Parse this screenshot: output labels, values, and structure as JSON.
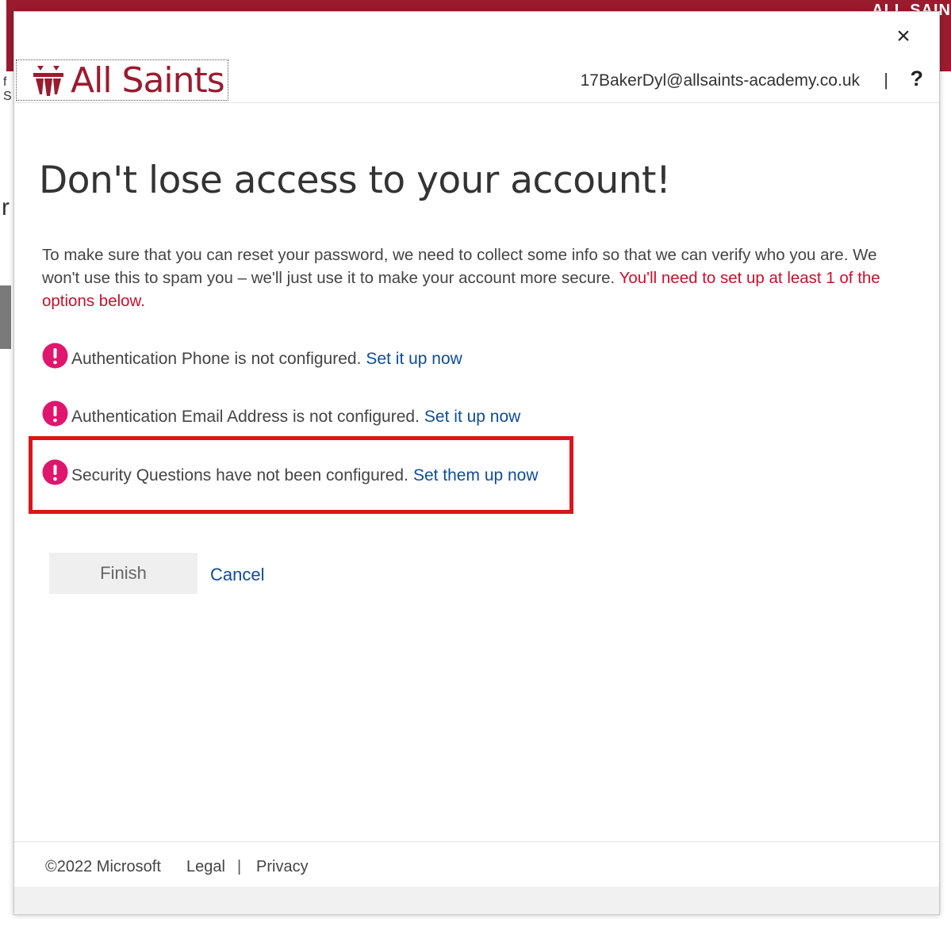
{
  "background": {
    "brand_text": "ALL SAIN",
    "left_glyph": "r",
    "left_small": "f\nS"
  },
  "dialog": {
    "close_label": "×",
    "logo_text": "All Saints",
    "user_email": "17BakerDyl@allsaints-academy.co.uk",
    "header_separator": "|",
    "help_label": "?",
    "title": "Don't lose access to your account!",
    "intro_text": "To make sure that you can reset your password, we need to collect some info so that we can verify who you are. We won't use this to spam you – we'll just use it to make your account more secure. ",
    "intro_warning": "You'll need to set up at least 1 of the options below.",
    "items": [
      {
        "text": "Authentication Phone is not configured.",
        "link": "Set it up now"
      },
      {
        "text": "Authentication Email Address is not configured.",
        "link": "Set it up now"
      },
      {
        "text": "Security Questions have not been configured.",
        "link": "Set them up now"
      }
    ],
    "finish_label": "Finish",
    "cancel_label": "Cancel"
  },
  "footer": {
    "copyright": "©2022 Microsoft",
    "legal": "Legal",
    "separator": "|",
    "privacy": "Privacy"
  },
  "colors": {
    "brand": "#9b1b2e",
    "warning_text": "#c8102e",
    "link": "#0f4c9b",
    "alert_icon": "#e0156e",
    "highlight_border": "#d9161c"
  }
}
